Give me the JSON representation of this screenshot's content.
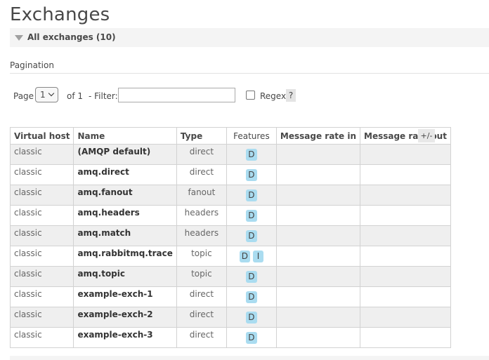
{
  "page": {
    "title": "Exchanges",
    "section_label": "All exchanges (10)"
  },
  "pagination": {
    "label": "Pagination",
    "page_label": "Page",
    "page_value": "1",
    "of_label": "of 1",
    "filter_label": "- Filter:",
    "filter_value": "",
    "regex_label": "Regex",
    "help_label": "?"
  },
  "table": {
    "columns": [
      "Virtual host",
      "Name",
      "Type",
      "Features",
      "Message rate in",
      "Message rate out"
    ],
    "toggle_columns_label": "+/-",
    "rows": [
      {
        "vhost": "classic",
        "name": "(AMQP default)",
        "type": "direct",
        "features": [
          "D"
        ],
        "rate_in": "",
        "rate_out": ""
      },
      {
        "vhost": "classic",
        "name": "amq.direct",
        "type": "direct",
        "features": [
          "D"
        ],
        "rate_in": "",
        "rate_out": ""
      },
      {
        "vhost": "classic",
        "name": "amq.fanout",
        "type": "fanout",
        "features": [
          "D"
        ],
        "rate_in": "",
        "rate_out": ""
      },
      {
        "vhost": "classic",
        "name": "amq.headers",
        "type": "headers",
        "features": [
          "D"
        ],
        "rate_in": "",
        "rate_out": ""
      },
      {
        "vhost": "classic",
        "name": "amq.match",
        "type": "headers",
        "features": [
          "D"
        ],
        "rate_in": "",
        "rate_out": ""
      },
      {
        "vhost": "classic",
        "name": "amq.rabbitmq.trace",
        "type": "topic",
        "features": [
          "D",
          "I"
        ],
        "rate_in": "",
        "rate_out": ""
      },
      {
        "vhost": "classic",
        "name": "amq.topic",
        "type": "topic",
        "features": [
          "D"
        ],
        "rate_in": "",
        "rate_out": ""
      },
      {
        "vhost": "classic",
        "name": "example-exch-1",
        "type": "direct",
        "features": [
          "D"
        ],
        "rate_in": "",
        "rate_out": ""
      },
      {
        "vhost": "classic",
        "name": "example-exch-2",
        "type": "direct",
        "features": [
          "D"
        ],
        "rate_in": "",
        "rate_out": ""
      },
      {
        "vhost": "classic",
        "name": "example-exch-3",
        "type": "direct",
        "features": [
          "D"
        ],
        "rate_in": "",
        "rate_out": ""
      }
    ]
  },
  "colors": {
    "feature_badge": "#aadcf0",
    "row_stripe": "#efefef",
    "section_bg": "#f4f4f4"
  }
}
